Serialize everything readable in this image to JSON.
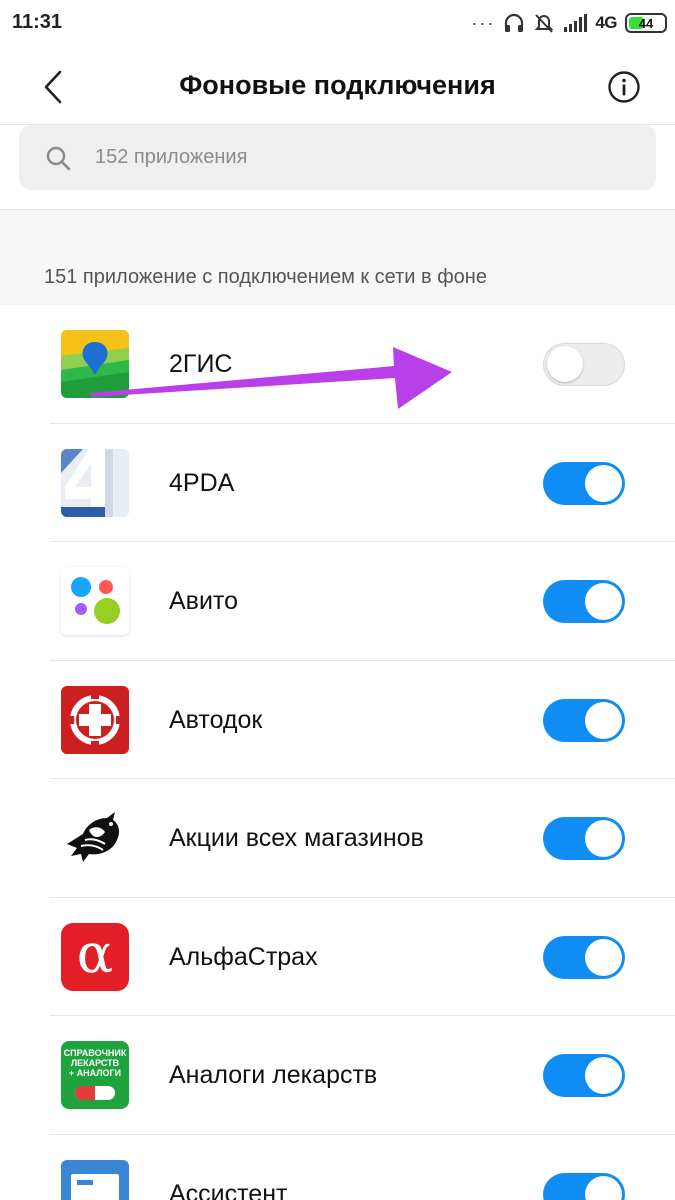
{
  "status_bar": {
    "time": "11:31",
    "network": "4G",
    "battery": "44",
    "battery_level": 0.44,
    "icons": [
      "headphones-icon",
      "mute-icon",
      "signal-icon",
      "battery-icon"
    ]
  },
  "header": {
    "title": "Фоновые подключения",
    "back_icon": "chevron-left-icon",
    "info_icon": "info-icon"
  },
  "search": {
    "placeholder": "152 приложения",
    "icon": "search-icon"
  },
  "section": {
    "label": "151 приложение с подключением к сети в фоне"
  },
  "apps": [
    {
      "name": "2ГИС",
      "enabled": false
    },
    {
      "name": "4PDA",
      "enabled": true
    },
    {
      "name": "Авито",
      "enabled": true
    },
    {
      "name": "Автодок",
      "enabled": true
    },
    {
      "name": "Акции всех магазинов",
      "enabled": true
    },
    {
      "name": "АльфаСтрах",
      "enabled": true
    },
    {
      "name": "Аналоги лекарств",
      "enabled": true
    },
    {
      "name": "Ассистент",
      "enabled": true
    }
  ],
  "icon_text": {
    "alfa": "α",
    "analogi": [
      "СПРАВОЧНИК",
      "ЛЕКАРСТВ",
      "+ АНАЛОГИ"
    ]
  },
  "colors": {
    "toggle_on": "#0f8df4",
    "toggle_off": "#ededed",
    "annotation_arrow": "#b940e8"
  }
}
